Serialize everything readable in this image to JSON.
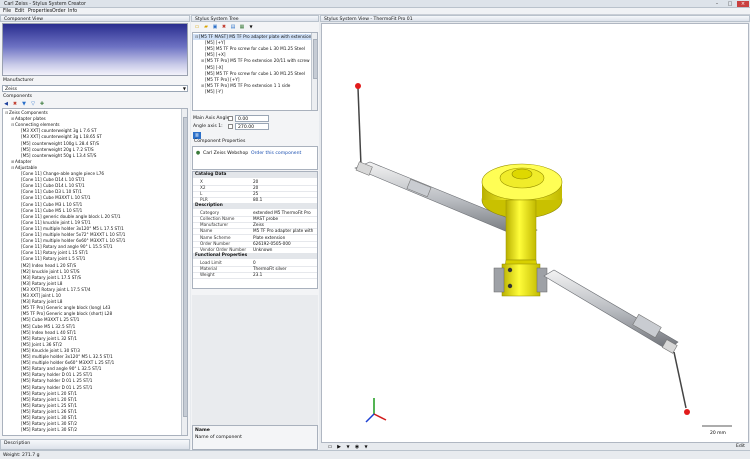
{
  "window": {
    "title": "Carl Zeiss - Stylus System Creator"
  },
  "menu": [
    "File",
    "Edit",
    "Properties",
    "Order",
    "Info"
  ],
  "left": {
    "component_view": "Component View",
    "manufacturer_label": "Manufacturer",
    "manufacturer_value": "Zeiss",
    "components_label": "Components",
    "tree": [
      {
        "t": "Zeiss Components",
        "d": 0,
        "e": "-"
      },
      {
        "t": "Adapter plates",
        "d": 1,
        "e": "+"
      },
      {
        "t": "Connecting elements",
        "d": 1,
        "e": "-"
      },
      {
        "t": "[M3 XXT] counterweight 3g L 7.6 ST",
        "d": 2
      },
      {
        "t": "[M3 XXT] counterweight 3g L 18.65 ST",
        "d": 2
      },
      {
        "t": "[M5] counterweight 100g L 28.4 ST/S",
        "d": 2
      },
      {
        "t": "[M5] counterweight 20g L 7.2 ST/S",
        "d": 2
      },
      {
        "t": "[M5] counterweight 50g L 13.4 ST/S",
        "d": 2
      },
      {
        "t": "Adapter",
        "d": 1,
        "e": "+"
      },
      {
        "t": "Adjustable",
        "d": 1,
        "e": "-"
      },
      {
        "t": "[Cone 11] Change-able angle piece L76",
        "d": 2
      },
      {
        "t": "[Cone 11] Cube D14 L 10 ST/1",
        "d": 2
      },
      {
        "t": "[Cone 11] Cube D14 L 10 ST/1",
        "d": 2
      },
      {
        "t": "[Cone 11] Cube D3 L 10 ST/1",
        "d": 2
      },
      {
        "t": "[Cone 11] Cube M3XXT L 10 ST/1",
        "d": 2
      },
      {
        "t": "[Cone 11] Cube M3 L 10 ST/1",
        "d": 2
      },
      {
        "t": "[Cone 11] Cube M5 L 10 ST/1",
        "d": 2
      },
      {
        "t": "[Cone 11] generic double angle block L 20 ST/1",
        "d": 2
      },
      {
        "t": "[Cone 11] knuckle joint L 19 ST/1",
        "d": 2
      },
      {
        "t": "[Cone 11] multiple holder 3x120° M5 L 17.5 ST/1",
        "d": 2
      },
      {
        "t": "[Cone 11] multiple holder 5x72° M3XXT L 10 ST/1",
        "d": 2
      },
      {
        "t": "[Cone 11] multiple holder 6x60° M3XXT L 10 ST/1",
        "d": 2
      },
      {
        "t": "[Cone 11] Rotary and angle 90° L 15.5 ST/1",
        "d": 2
      },
      {
        "t": "[Cone 11] Rotary joint L 15 ST/1",
        "d": 2
      },
      {
        "t": "[Cone 11] Rotary joint L 5 ST/1",
        "d": 2
      },
      {
        "t": "[M2] Index head L 20 ST/S",
        "d": 2
      },
      {
        "t": "[M2] knuckle joint L 10 ST/S",
        "d": 2
      },
      {
        "t": "[M3] Rotary joint L 17.5 ST/S",
        "d": 2
      },
      {
        "t": "[M3] Rotary joint L8",
        "d": 2
      },
      {
        "t": "[M3 XXT] Rotary joint L 17.5 ST/4",
        "d": 2
      },
      {
        "t": "[M3 XXT] joint L 10",
        "d": 2
      },
      {
        "t": "[M3] Rotary joint L8",
        "d": 2
      },
      {
        "t": "[M5 TF Pro] Generic angle block (long) L43",
        "d": 2
      },
      {
        "t": "[M5 TF Pro] Generic angle block (short) L28",
        "d": 2
      },
      {
        "t": "[M5] Cube M3XXT L 25 ST/1",
        "d": 2
      },
      {
        "t": "[M5] Cube M5 L 32.5 ST/1",
        "d": 2
      },
      {
        "t": "[M5] Index head L 40 ST/1",
        "d": 2
      },
      {
        "t": "[M5] Rotary joint L 32 ST/1",
        "d": 2
      },
      {
        "t": "[M5] Joint L 36 ST/2",
        "d": 2
      },
      {
        "t": "[M5] Knuckle joint L 30 ST/3",
        "d": 2
      },
      {
        "t": "[M5] multiple holder 3x120° M5 L 32.5 ST/1",
        "d": 2
      },
      {
        "t": "[M5] multiple holder 6x60° M3XXT L 25 ST/1",
        "d": 2
      },
      {
        "t": "[M5] Rotary and angle 90° L 32.5 ST/1",
        "d": 2
      },
      {
        "t": "[M5] Rotary holder D 01 L 25 ST/1",
        "d": 2
      },
      {
        "t": "[M5] Rotary holder D 01 L 25 ST/1",
        "d": 2
      },
      {
        "t": "[M5] Rotary holder D 01 L 25 ST/1",
        "d": 2
      },
      {
        "t": "[M5] Rotary joint L 20 ST/1",
        "d": 2
      },
      {
        "t": "[M5] Rotary joint L 20 ST/1",
        "d": 2
      },
      {
        "t": "[M5] Rotary joint L 25 ST/1",
        "d": 2
      },
      {
        "t": "[M5] Rotary joint L 26 ST/1",
        "d": 2
      },
      {
        "t": "[M5] Rotary joint L 30 ST/1",
        "d": 2
      },
      {
        "t": "[M5] Rotary joint L 30 ST/2",
        "d": 2
      },
      {
        "t": "[M5] Rotary joint L 30 ST/2",
        "d": 2
      }
    ],
    "description_label": "Description"
  },
  "mid": {
    "tree_title": "Stylus System Tree",
    "tree": [
      {
        "t": "[M5 TF MAST] M5 TF Pro adapter plate with extension L2(...)",
        "d": 0,
        "e": "-",
        "sel": true
      },
      {
        "t": "[M5] [+Y]",
        "d": 1
      },
      {
        "t": "[M5] M5 TF Pro screw for cube L 30 M1.25 Steel",
        "d": 1
      },
      {
        "t": "[M5] [+X]",
        "d": 1
      },
      {
        "t": "[M5 TF Pro] M5 TF Pro extension 20/11 with screw",
        "d": 1,
        "e": "+"
      },
      {
        "t": "[M5] [-X]",
        "d": 1
      },
      {
        "t": "[M5] M5 TF Pro screw for cube L 30 M1.25 Steel",
        "d": 1
      },
      {
        "t": "[M5 TF Pro] [+Y]",
        "d": 1
      },
      {
        "t": "[M5 TF Pro] M5 TF Pro extension 1 1 side",
        "d": 1,
        "e": "+"
      },
      {
        "t": "[M5] [-Y]",
        "d": 1
      }
    ],
    "main_axis_label": "Main Axis Angle:",
    "main_axis_value": "0.00",
    "angle_axis_label": "Angle axis 1:",
    "angle_axis_value": "270.00",
    "comp_props": "Component Properties",
    "webshop": "Carl Zeiss Webshop",
    "order": "Order this component",
    "sections": [
      {
        "title": "Catalog Data",
        "rows": [
          [
            "X",
            "20"
          ],
          [
            "X2",
            "20"
          ],
          [
            "L",
            "25"
          ],
          [
            "PLR",
            "80.1"
          ]
        ]
      },
      {
        "title": "Description",
        "rows": [
          [
            "Category",
            "extended M5 ThermoFit Pro"
          ],
          [
            "Collection Name",
            "MAST probe"
          ],
          [
            "Manufacturer",
            "Zeiss"
          ],
          [
            "Name",
            "M5 TF Pro adapter plate with"
          ],
          [
            "Name Scheme",
            "Plate extension"
          ],
          [
            "Order Number",
            "626192-0505-000"
          ],
          [
            "Vendor Order Number",
            "Unknown"
          ]
        ]
      },
      {
        "title": "Functional Properties",
        "rows": [
          [
            "Load Limit",
            "0"
          ],
          [
            "Material",
            "ThermoFit silver"
          ],
          [
            "Weight",
            "23.1"
          ]
        ]
      }
    ],
    "name_label": "Name",
    "name_desc": "Name of component"
  },
  "right": {
    "view_title": "Stylus System View - ThermoFit Pro 01",
    "scale_label": "20 mm",
    "edit_label": "Edit"
  },
  "status": {
    "weight": "Weight: 271.7 g"
  }
}
